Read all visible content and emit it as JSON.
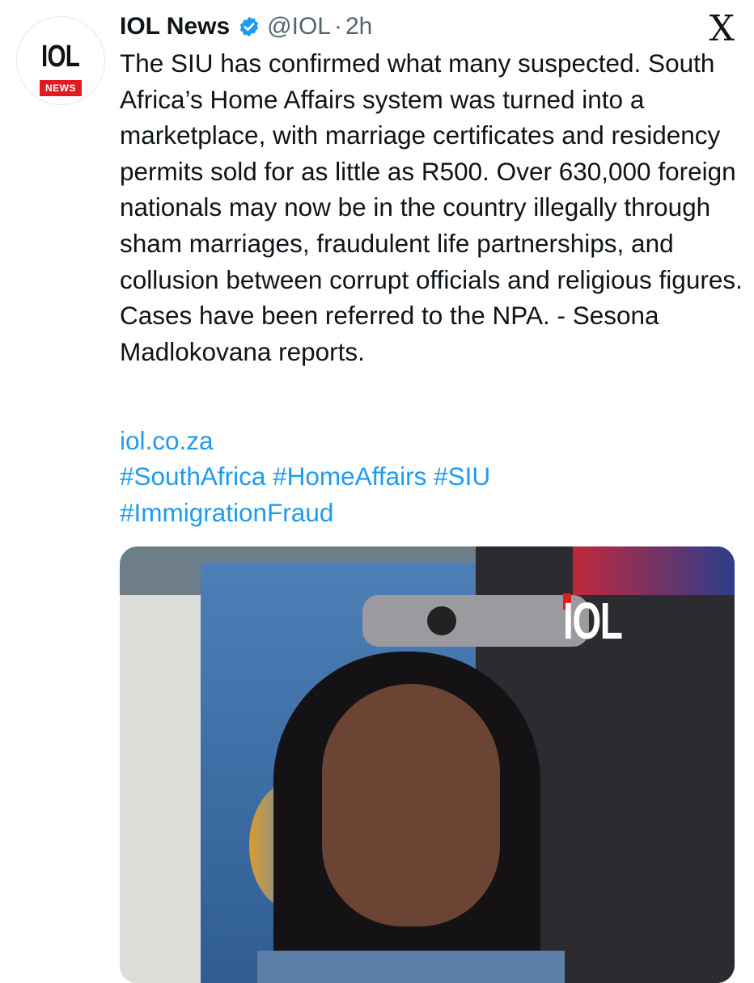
{
  "tweet": {
    "author": {
      "avatar_mark": "IOL",
      "avatar_tag": "NEWS",
      "name": "IOL News",
      "handle": "@IOL",
      "separator": "·",
      "time": "2h"
    },
    "close_glyph": "X",
    "text": "The SIU has confirmed what many suspected. South Africa’s Home Affairs system was turned into a marketplace, with marriage certificates and residency permits sold for as little as R500. Over 630,000 foreign nationals may now be in the country illegally through sham marriages, fraudulent life partnerships, and collusion between corrupt officials and religious figures. Cases have been referred to the NPA. - Sesona Madlokovana reports.",
    "link": "iol.co.za",
    "hashtags_line1": "#SouthAfrica #HomeAffairs #SIU",
    "hashtags_line2": "#ImmigrationFraud",
    "media": {
      "overlay_logo": "IOL"
    }
  },
  "colors": {
    "link": "#1d9bf0",
    "brand_red": "#e01b22",
    "text": "#0f1419",
    "muted": "#536471"
  }
}
